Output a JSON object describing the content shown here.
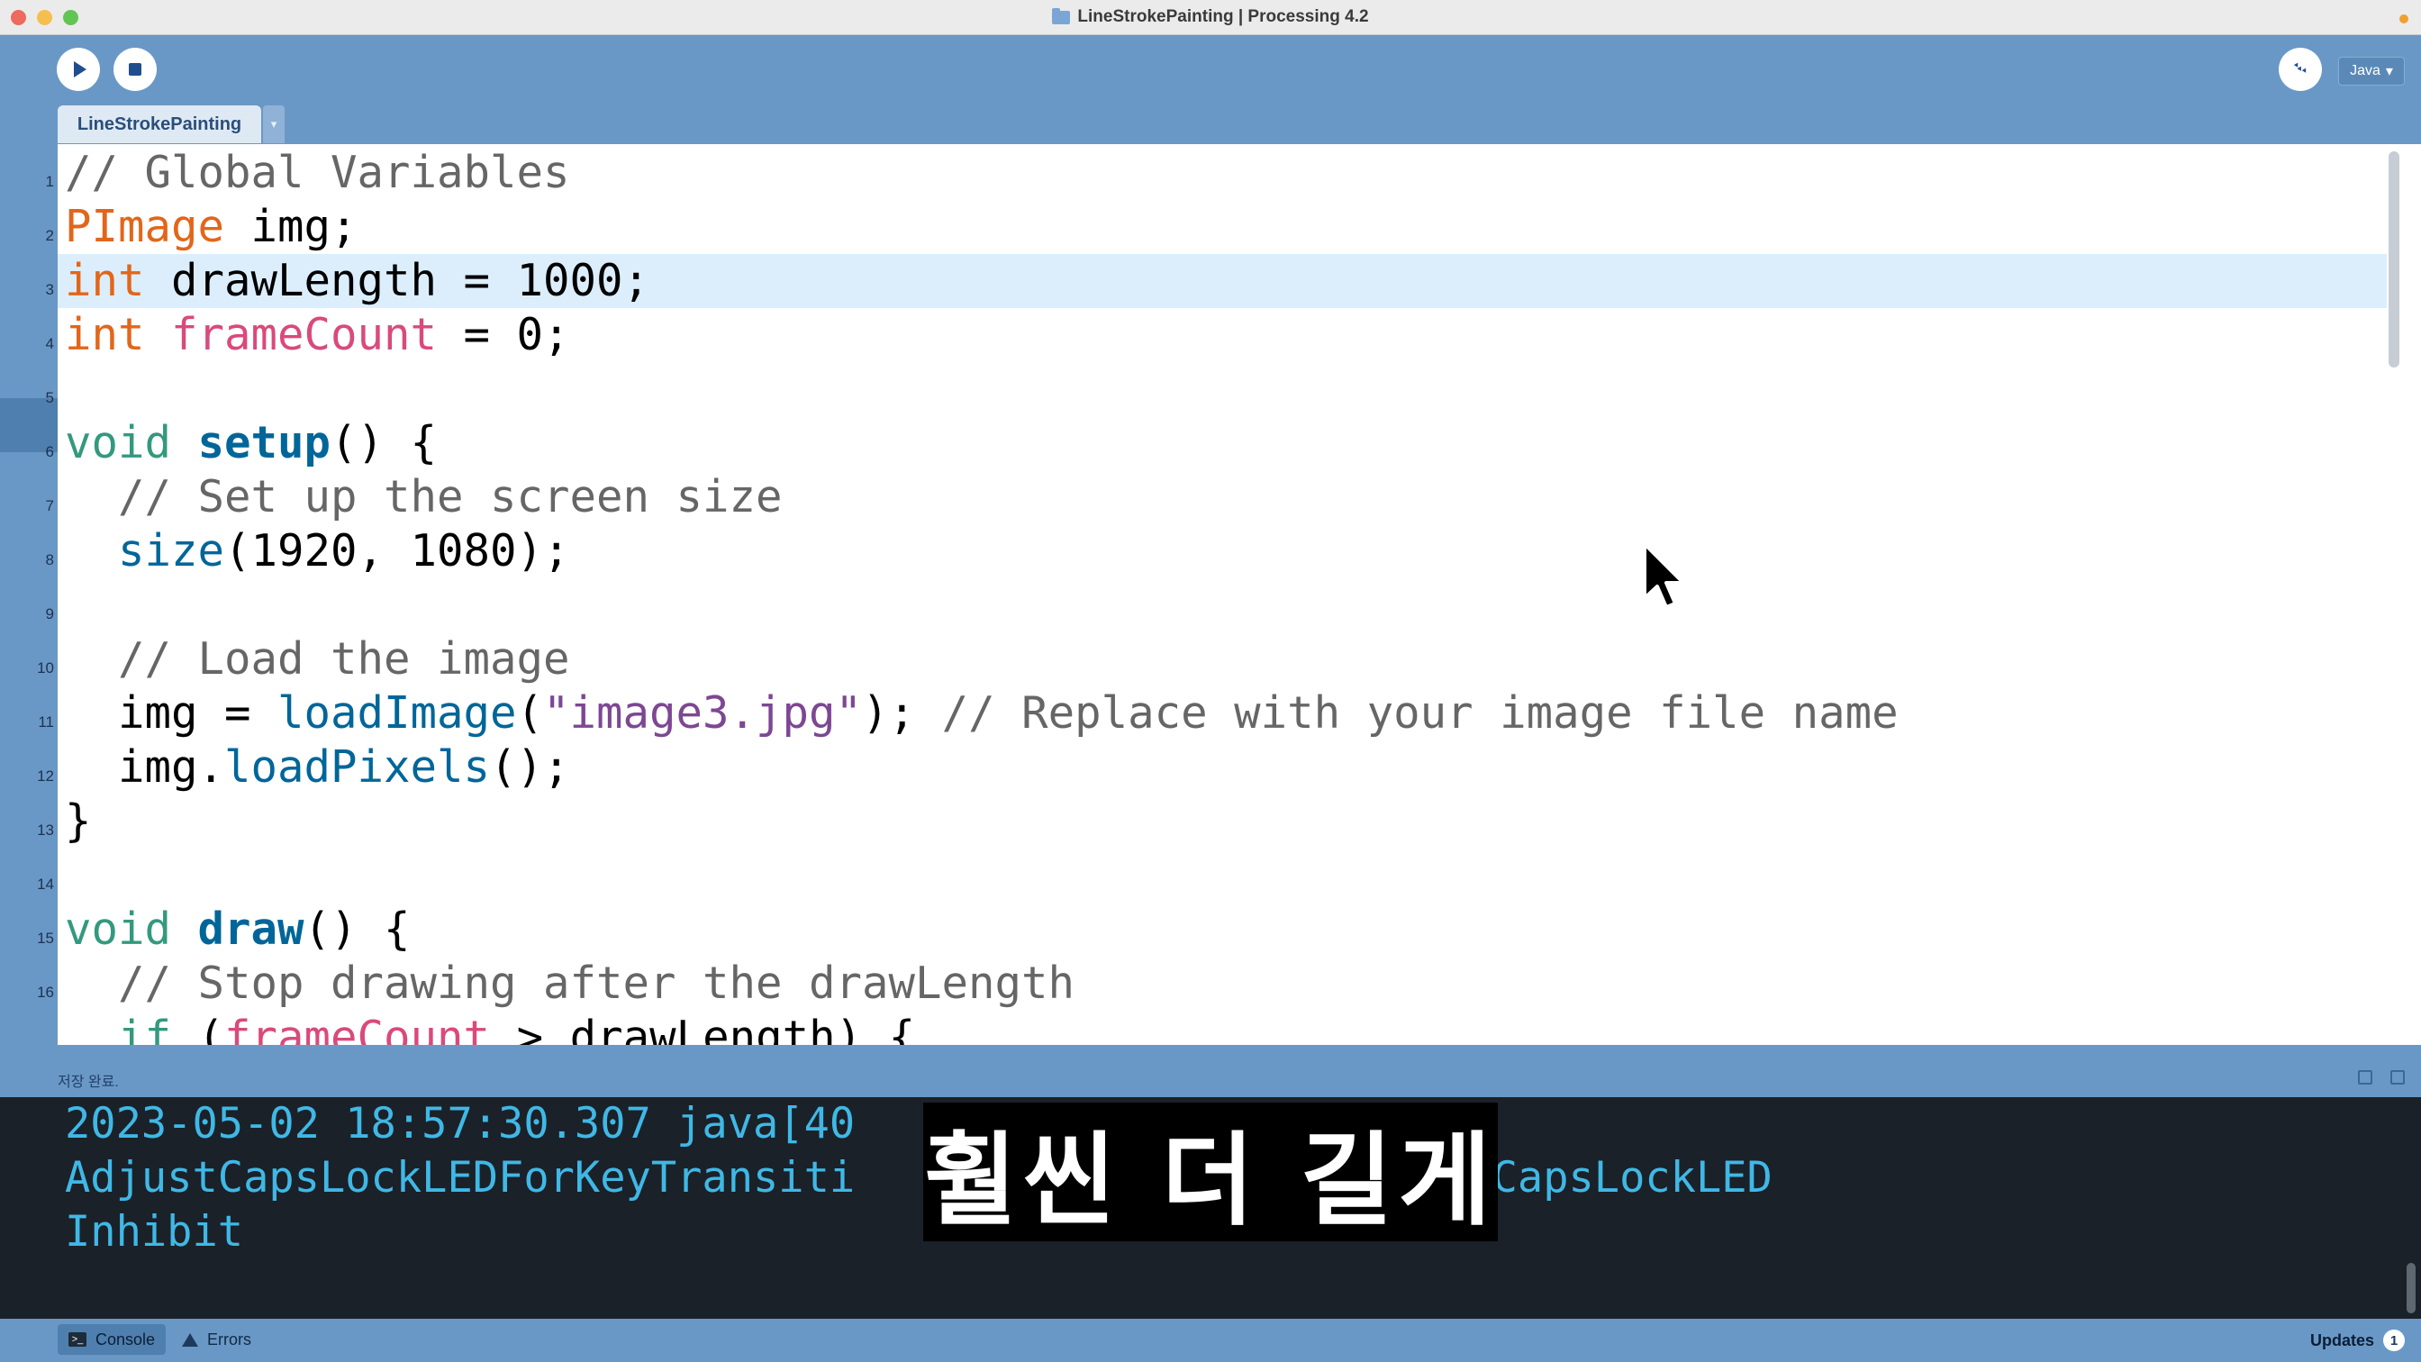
{
  "window": {
    "title": "LineStrokePainting | Processing 4.2"
  },
  "toolbar": {
    "run_icon": "play-icon",
    "stop_icon": "stop-icon",
    "debug_icon": "bug-icon",
    "debug_glyph": "࿙",
    "mode_label": "Java",
    "mode_arrow": "▾"
  },
  "tabs": {
    "sketch_tab": "LineStrokePainting",
    "menu_arrow": "▾"
  },
  "editor": {
    "current_line": 3,
    "line_numbers": [
      "1",
      "2",
      "3",
      "4",
      "5",
      "6",
      "7",
      "8",
      "9",
      "10",
      "11",
      "12",
      "13",
      "14",
      "15",
      "16"
    ],
    "lines": [
      [
        {
          "t": "// Global Variables",
          "c": "com"
        }
      ],
      [
        {
          "t": "PImage",
          "c": "type"
        },
        {
          "t": " img;",
          "c": ""
        }
      ],
      [
        {
          "t": "int",
          "c": "type"
        },
        {
          "t": " drawLength = 1000;",
          "c": ""
        }
      ],
      [
        {
          "t": "int",
          "c": "type"
        },
        {
          "t": " ",
          "c": ""
        },
        {
          "t": "frameCount",
          "c": "var"
        },
        {
          "t": " = 0;",
          "c": ""
        }
      ],
      [],
      [
        {
          "t": "void",
          "c": "kw"
        },
        {
          "t": " ",
          "c": ""
        },
        {
          "t": "setup",
          "c": "fn"
        },
        {
          "t": "() {",
          "c": ""
        }
      ],
      [
        {
          "t": "  // Set up the screen size",
          "c": "com"
        }
      ],
      [
        {
          "t": "  ",
          "c": ""
        },
        {
          "t": "size",
          "c": "call"
        },
        {
          "t": "(1920, 1080);",
          "c": ""
        }
      ],
      [],
      [
        {
          "t": "  // Load the image",
          "c": "com"
        }
      ],
      [
        {
          "t": "  img = ",
          "c": ""
        },
        {
          "t": "loadImage",
          "c": "call"
        },
        {
          "t": "(",
          "c": ""
        },
        {
          "t": "\"image3.jpg\"",
          "c": "str"
        },
        {
          "t": "); ",
          "c": ""
        },
        {
          "t": "// Replace with your image file name",
          "c": "com"
        }
      ],
      [
        {
          "t": "  img.",
          "c": ""
        },
        {
          "t": "loadPixels",
          "c": "call"
        },
        {
          "t": "();",
          "c": ""
        }
      ],
      [
        {
          "t": "}",
          "c": ""
        }
      ],
      [],
      [
        {
          "t": "void",
          "c": "kw"
        },
        {
          "t": " ",
          "c": ""
        },
        {
          "t": "draw",
          "c": "fn"
        },
        {
          "t": "() {",
          "c": ""
        }
      ],
      [
        {
          "t": "  // Stop drawing after the drawLength",
          "c": "com"
        }
      ],
      [
        {
          "t": "  ",
          "c": ""
        },
        {
          "t": "if",
          "c": "kw"
        },
        {
          "t": " (",
          "c": ""
        },
        {
          "t": "frameCount",
          "c": "var"
        },
        {
          "t": " > drawLength) {",
          "c": ""
        }
      ]
    ]
  },
  "status": {
    "message": "저장 완료."
  },
  "console": {
    "lines": [
      "2023-05-02 18:57:30.307 java[40",
      "AdjustCapsLockLEDForKeyTransiti          hysicalKeyboardCapsLockLED",
      "Inhibit"
    ]
  },
  "subtitle": {
    "text": "훨씬 더 길게"
  },
  "bottom_tabs": {
    "console_label": "Console",
    "errors_label": "Errors",
    "updates_label": "Updates",
    "updates_count": "1"
  },
  "colors": {
    "chrome_blue": "#6a98c6",
    "comment": "#666666",
    "type": "#e2661a",
    "keyword": "#33997e",
    "function": "#006699",
    "string": "#7d4793",
    "console_text": "#3fb8e6"
  }
}
